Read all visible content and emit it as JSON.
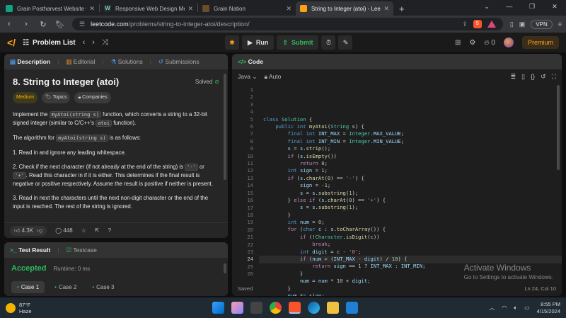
{
  "browser": {
    "tabs": [
      {
        "title": "Grain Postharvest Website Creation",
        "favicon_color": "#10a37f",
        "active": false
      },
      {
        "title": "Responsive Web Design Media Que",
        "favicon_color": "#2c2c2c",
        "active": false
      },
      {
        "title": "Grain Nation",
        "favicon_color": "#6b4b2a",
        "active": false
      },
      {
        "title": "String to Integer (atoi) - LeetCo",
        "favicon_color": "#ffa116",
        "active": true
      }
    ],
    "url_domain": "leetcode.com",
    "url_path": "/problems/string-to-integer-atoi/description/",
    "vpn_label": "VPN",
    "shield_count": "5"
  },
  "lcnav": {
    "problem_list": "Problem List",
    "run": "Run",
    "submit": "Submit",
    "fire_count": "0",
    "premium": "Premium"
  },
  "left_panel": {
    "tabs": [
      "Description",
      "Editorial",
      "Solutions",
      "Submissions"
    ],
    "title": "8. String to Integer (atoi)",
    "solved": "Solved",
    "tags": [
      "Medium",
      "Topics",
      "Companies"
    ],
    "para1_a": "Implement the ",
    "para1_code": "myAtoi(string s)",
    "para1_b": " function, which converts a string to a 32-bit signed integer (similar to C/C++'s ",
    "para1_code2": "atoi",
    "para1_c": " function).",
    "para2_a": "The algorithm for ",
    "para2_code": "myAtoi(string s)",
    "para2_b": " is as follows:",
    "step1": "1. Read in and ignore any leading whitespace.",
    "step2_a": "2. Check if the next character (if not already at the end of the string) is ",
    "step2_code1": "'-'",
    "step2_b": " or ",
    "step2_code2": "'+'",
    "step2_c": ". Read this character in if it is either. This determines if the final result is negative or positive respectively. Assume the result is positive if neither is present.",
    "step3": "3. Read in next the characters until the next non-digit character or the end of the input is reached. The rest of the string is ignored.",
    "likes": "4.3K",
    "comments": "448"
  },
  "test_panel": {
    "tabs": [
      "Test Result",
      "Testcase"
    ],
    "status": "Accepted",
    "runtime": "Runtime: 0 ms",
    "cases": [
      "Case 1",
      "Case 2",
      "Case 3"
    ]
  },
  "editor": {
    "header": "Code",
    "language": "Java",
    "mode": "Auto",
    "footer_left": "Saved",
    "footer_right": "Ln 24, Col 10",
    "line_numbers": [
      "1",
      "2",
      "3",
      "4",
      "5",
      "6",
      "7",
      "8",
      "9",
      "10",
      "11",
      "12",
      "13",
      "14",
      "15",
      "16",
      "17",
      "18",
      "19",
      "20",
      "21",
      "22",
      "23",
      "24",
      "25",
      "26"
    ],
    "cursor_line": 24
  },
  "watermark": {
    "line1": "Activate Windows",
    "line2": "Go to Settings to activate Windows."
  },
  "taskbar": {
    "temp": "87°F",
    "weather": "Haze",
    "time": "8:55 PM",
    "date": "4/15/2024"
  }
}
